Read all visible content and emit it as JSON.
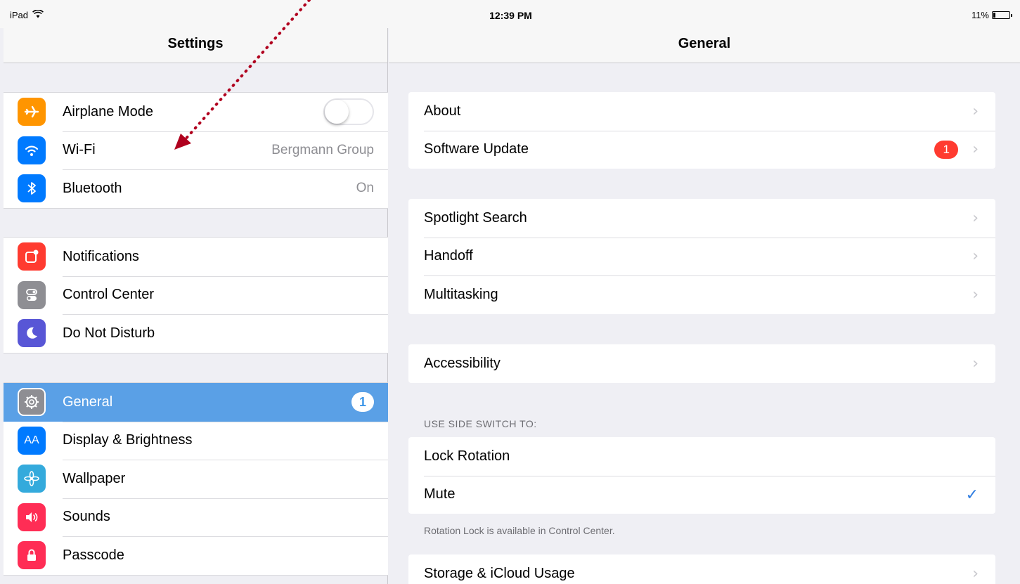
{
  "status_bar": {
    "device": "iPad",
    "time": "12:39 PM",
    "battery": "11%",
    "battery_level": 0.11
  },
  "sidebar": {
    "title": "Settings",
    "groups": [
      [
        {
          "label": "Airplane Mode",
          "icon": "airplane-icon",
          "color": "#ff9500",
          "accessory": "toggle",
          "toggle_on": false
        },
        {
          "label": "Wi-Fi",
          "icon": "wifi-icon",
          "color": "#007aff",
          "value": "Bergmann Group"
        },
        {
          "label": "Bluetooth",
          "icon": "bluetooth-icon",
          "color": "#007aff",
          "value": "On"
        }
      ],
      [
        {
          "label": "Notifications",
          "icon": "notifications-icon",
          "color": "#ff3b30"
        },
        {
          "label": "Control Center",
          "icon": "control-center-icon",
          "color": "#8e8e93"
        },
        {
          "label": "Do Not Disturb",
          "icon": "moon-icon",
          "color": "#5856d6"
        }
      ],
      [
        {
          "label": "General",
          "icon": "gear-icon",
          "color": "#8e8e93",
          "badge": "1",
          "selected": true
        },
        {
          "label": "Display & Brightness",
          "icon": "display-brightness-icon",
          "color": "#007aff",
          "glyph": "AA"
        },
        {
          "label": "Wallpaper",
          "icon": "wallpaper-icon",
          "color": "#34aadc"
        },
        {
          "label": "Sounds",
          "icon": "speaker-icon",
          "color": "#ff2d55"
        },
        {
          "label": "Passcode",
          "icon": "lock-icon",
          "color": "#ff2d55"
        }
      ]
    ]
  },
  "detail": {
    "title": "General",
    "groups": [
      {
        "rows": [
          {
            "label": "About"
          },
          {
            "label": "Software Update",
            "badge": "1"
          }
        ]
      },
      {
        "rows": [
          {
            "label": "Spotlight Search"
          },
          {
            "label": "Handoff"
          },
          {
            "label": "Multitasking"
          }
        ]
      },
      {
        "rows": [
          {
            "label": "Accessibility"
          }
        ]
      },
      {
        "header": "USE SIDE SWITCH TO:",
        "footer": "Rotation Lock is available in Control Center.",
        "rows": [
          {
            "label": "Lock Rotation",
            "chevron": false
          },
          {
            "label": "Mute",
            "chevron": false,
            "checked": true
          }
        ]
      },
      {
        "rows": [
          {
            "label": "Storage & iCloud Usage"
          }
        ]
      }
    ]
  },
  "colors": {
    "selected_row": "#5aa0e6",
    "badge_red": "#ff3b30",
    "checkmark": "#2f7de1",
    "annotation_arrow": "#b0001e"
  }
}
